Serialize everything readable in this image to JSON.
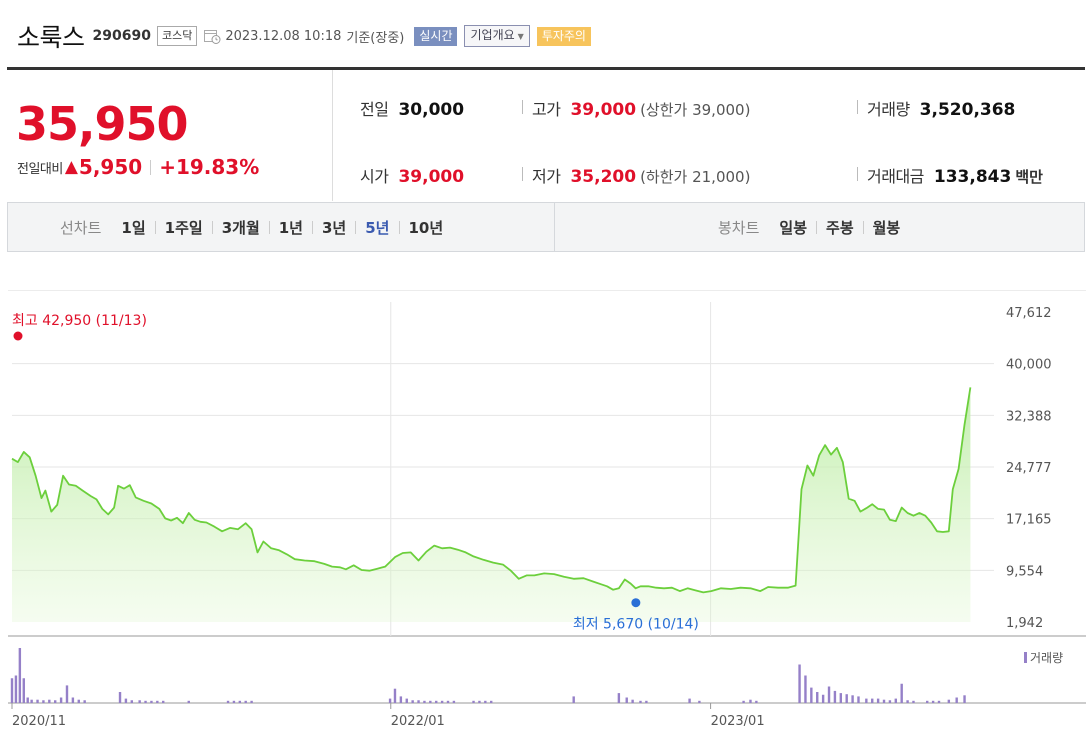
{
  "header": {
    "stock_name": "소룩스",
    "stock_code": "290690",
    "market": "코스닥",
    "datetime": "2023.12.08 10:18",
    "basis": "기준(장중)",
    "realtime_tag": "실시간",
    "company_tag": "기업개요",
    "warning_tag": "투자주의"
  },
  "summary": {
    "current_price": "35,950",
    "change_label": "전일대비",
    "change_arrow": "▲",
    "change_amount": "5,950",
    "change_percent": "+19.83%",
    "prev_close": {
      "label": "전일",
      "value": "30,000"
    },
    "open": {
      "label": "시가",
      "value": "39,000"
    },
    "high": {
      "label": "고가",
      "value": "39,000",
      "note": "(상한가 39,000)"
    },
    "low": {
      "label": "저가",
      "value": "35,200",
      "note": "(하한가 21,000)"
    },
    "volume": {
      "label": "거래량",
      "value": "3,520,368"
    },
    "trade_value": {
      "label": "거래대금",
      "value": "133,843",
      "unit": "백만"
    },
    "up_color": "#e0102a"
  },
  "periods": {
    "label": "선차트",
    "options": [
      "1일",
      "1주일",
      "3개월",
      "1년",
      "3년",
      "5년",
      "10년"
    ],
    "active": "5년",
    "candle_label": "봉차트",
    "candle_options": [
      "일봉",
      "주봉",
      "월봉"
    ]
  },
  "chart_data": {
    "type": "area",
    "y_ticks": [
      "47,612",
      "40,000",
      "32,388",
      "24,777",
      "17,165",
      "9,554",
      "1,942"
    ],
    "ylim": [
      1942,
      47612
    ],
    "x_ticks": [
      {
        "label": "2020/11",
        "pos": 0.0
      },
      {
        "label": "2022/01",
        "pos": 0.3857
      },
      {
        "label": "2023/01",
        "pos": 0.7114
      }
    ],
    "high_annotation": "최고 42,950 (11/13)",
    "low_annotation": "최저 5,670 (10/14)",
    "low_point": {
      "pos": 0.6353,
      "value": 5670
    },
    "volume_legend": "거래량",
    "line_color": "#6ccf3c",
    "fill_color": "#d8f5c4",
    "volume_color": "#9580c8",
    "price_series": [
      [
        0.0,
        26000
      ],
      [
        0.006,
        25500
      ],
      [
        0.012,
        27000
      ],
      [
        0.018,
        26200
      ],
      [
        0.024,
        23500
      ],
      [
        0.03,
        20200
      ],
      [
        0.034,
        21300
      ],
      [
        0.04,
        18200
      ],
      [
        0.046,
        19200
      ],
      [
        0.052,
        23500
      ],
      [
        0.058,
        22200
      ],
      [
        0.065,
        22000
      ],
      [
        0.072,
        21300
      ],
      [
        0.08,
        20500
      ],
      [
        0.086,
        20000
      ],
      [
        0.092,
        18600
      ],
      [
        0.098,
        17800
      ],
      [
        0.104,
        18800
      ],
      [
        0.108,
        22000
      ],
      [
        0.114,
        21600
      ],
      [
        0.12,
        22100
      ],
      [
        0.126,
        20300
      ],
      [
        0.134,
        19800
      ],
      [
        0.142,
        19400
      ],
      [
        0.15,
        18600
      ],
      [
        0.156,
        17200
      ],
      [
        0.162,
        16900
      ],
      [
        0.168,
        17300
      ],
      [
        0.174,
        16500
      ],
      [
        0.18,
        18000
      ],
      [
        0.186,
        17000
      ],
      [
        0.192,
        16700
      ],
      [
        0.198,
        16600
      ],
      [
        0.206,
        16000
      ],
      [
        0.214,
        15300
      ],
      [
        0.222,
        15800
      ],
      [
        0.23,
        15600
      ],
      [
        0.238,
        16500
      ],
      [
        0.244,
        15600
      ],
      [
        0.25,
        12200
      ],
      [
        0.256,
        13800
      ],
      [
        0.264,
        12800
      ],
      [
        0.272,
        12500
      ],
      [
        0.28,
        11900
      ],
      [
        0.288,
        11200
      ],
      [
        0.298,
        11000
      ],
      [
        0.308,
        10900
      ],
      [
        0.318,
        10500
      ],
      [
        0.326,
        10100
      ],
      [
        0.334,
        10000
      ],
      [
        0.34,
        9700
      ],
      [
        0.348,
        10300
      ],
      [
        0.356,
        9600
      ],
      [
        0.364,
        9500
      ],
      [
        0.372,
        9800
      ],
      [
        0.38,
        10100
      ],
      [
        0.39,
        11500
      ],
      [
        0.398,
        12100
      ],
      [
        0.406,
        12200
      ],
      [
        0.414,
        11000
      ],
      [
        0.422,
        12300
      ],
      [
        0.43,
        13200
      ],
      [
        0.438,
        12800
      ],
      [
        0.446,
        12900
      ],
      [
        0.454,
        12600
      ],
      [
        0.462,
        12200
      ],
      [
        0.47,
        11600
      ],
      [
        0.48,
        11100
      ],
      [
        0.49,
        10700
      ],
      [
        0.5,
        10400
      ],
      [
        0.508,
        9500
      ],
      [
        0.516,
        8300
      ],
      [
        0.524,
        8800
      ],
      [
        0.532,
        8800
      ],
      [
        0.542,
        9100
      ],
      [
        0.552,
        9000
      ],
      [
        0.562,
        8600
      ],
      [
        0.572,
        8300
      ],
      [
        0.582,
        8400
      ],
      [
        0.592,
        7900
      ],
      [
        0.6,
        7500
      ],
      [
        0.606,
        7200
      ],
      [
        0.612,
        6700
      ],
      [
        0.618,
        6900
      ],
      [
        0.624,
        8200
      ],
      [
        0.63,
        7600
      ],
      [
        0.635,
        6900
      ],
      [
        0.64,
        7200
      ],
      [
        0.648,
        7200
      ],
      [
        0.656,
        7000
      ],
      [
        0.664,
        6900
      ],
      [
        0.672,
        7000
      ],
      [
        0.68,
        6500
      ],
      [
        0.688,
        6900
      ],
      [
        0.696,
        6600
      ],
      [
        0.704,
        6300
      ],
      [
        0.712,
        6500
      ],
      [
        0.722,
        6900
      ],
      [
        0.732,
        6800
      ],
      [
        0.742,
        7000
      ],
      [
        0.752,
        6900
      ],
      [
        0.762,
        6500
      ],
      [
        0.77,
        7100
      ],
      [
        0.78,
        7000
      ],
      [
        0.79,
        7000
      ],
      [
        0.798,
        7300
      ],
      [
        0.804,
        21500
      ],
      [
        0.81,
        25000
      ],
      [
        0.816,
        23500
      ],
      [
        0.822,
        26500
      ],
      [
        0.828,
        28000
      ],
      [
        0.834,
        26600
      ],
      [
        0.84,
        27600
      ],
      [
        0.846,
        25500
      ],
      [
        0.852,
        20100
      ],
      [
        0.858,
        19800
      ],
      [
        0.864,
        18200
      ],
      [
        0.87,
        18700
      ],
      [
        0.876,
        19300
      ],
      [
        0.882,
        18600
      ],
      [
        0.888,
        18500
      ],
      [
        0.894,
        17000
      ],
      [
        0.9,
        16800
      ],
      [
        0.906,
        18800
      ],
      [
        0.912,
        18000
      ],
      [
        0.918,
        17600
      ],
      [
        0.924,
        18000
      ],
      [
        0.93,
        17600
      ],
      [
        0.936,
        16600
      ],
      [
        0.942,
        15300
      ],
      [
        0.948,
        15200
      ],
      [
        0.954,
        15300
      ],
      [
        0.958,
        21500
      ],
      [
        0.964,
        24500
      ],
      [
        0.97,
        31000
      ],
      [
        0.976,
        36500
      ]
    ],
    "volume_bars": [
      [
        0.0,
        0.45
      ],
      [
        0.004,
        0.5
      ],
      [
        0.008,
        1.0
      ],
      [
        0.012,
        0.45
      ],
      [
        0.016,
        0.1
      ],
      [
        0.02,
        0.06
      ],
      [
        0.026,
        0.06
      ],
      [
        0.032,
        0.05
      ],
      [
        0.038,
        0.06
      ],
      [
        0.044,
        0.05
      ],
      [
        0.05,
        0.1
      ],
      [
        0.056,
        0.32
      ],
      [
        0.062,
        0.1
      ],
      [
        0.068,
        0.06
      ],
      [
        0.074,
        0.05
      ],
      [
        0.11,
        0.2
      ],
      [
        0.116,
        0.08
      ],
      [
        0.122,
        0.05
      ],
      [
        0.13,
        0.05
      ],
      [
        0.136,
        0.04
      ],
      [
        0.142,
        0.04
      ],
      [
        0.148,
        0.04
      ],
      [
        0.154,
        0.04
      ],
      [
        0.18,
        0.04
      ],
      [
        0.22,
        0.04
      ],
      [
        0.226,
        0.04
      ],
      [
        0.232,
        0.04
      ],
      [
        0.238,
        0.04
      ],
      [
        0.244,
        0.04
      ],
      [
        0.385,
        0.08
      ],
      [
        0.39,
        0.26
      ],
      [
        0.396,
        0.12
      ],
      [
        0.402,
        0.08
      ],
      [
        0.408,
        0.05
      ],
      [
        0.414,
        0.05
      ],
      [
        0.42,
        0.04
      ],
      [
        0.426,
        0.04
      ],
      [
        0.432,
        0.04
      ],
      [
        0.438,
        0.04
      ],
      [
        0.444,
        0.04
      ],
      [
        0.45,
        0.04
      ],
      [
        0.47,
        0.04
      ],
      [
        0.476,
        0.04
      ],
      [
        0.482,
        0.04
      ],
      [
        0.488,
        0.04
      ],
      [
        0.572,
        0.12
      ],
      [
        0.618,
        0.18
      ],
      [
        0.626,
        0.1
      ],
      [
        0.632,
        0.06
      ],
      [
        0.64,
        0.04
      ],
      [
        0.646,
        0.04
      ],
      [
        0.69,
        0.08
      ],
      [
        0.7,
        0.04
      ],
      [
        0.745,
        0.04
      ],
      [
        0.752,
        0.06
      ],
      [
        0.758,
        0.04
      ],
      [
        0.802,
        0.7
      ],
      [
        0.808,
        0.5
      ],
      [
        0.814,
        0.28
      ],
      [
        0.82,
        0.2
      ],
      [
        0.826,
        0.15
      ],
      [
        0.832,
        0.3
      ],
      [
        0.838,
        0.22
      ],
      [
        0.844,
        0.18
      ],
      [
        0.85,
        0.16
      ],
      [
        0.856,
        0.14
      ],
      [
        0.862,
        0.12
      ],
      [
        0.87,
        0.08
      ],
      [
        0.876,
        0.08
      ],
      [
        0.882,
        0.08
      ],
      [
        0.888,
        0.06
      ],
      [
        0.894,
        0.05
      ],
      [
        0.9,
        0.08
      ],
      [
        0.906,
        0.35
      ],
      [
        0.912,
        0.05
      ],
      [
        0.918,
        0.04
      ],
      [
        0.932,
        0.04
      ],
      [
        0.938,
        0.04
      ],
      [
        0.944,
        0.04
      ],
      [
        0.954,
        0.06
      ],
      [
        0.962,
        0.1
      ],
      [
        0.97,
        0.14
      ]
    ]
  }
}
